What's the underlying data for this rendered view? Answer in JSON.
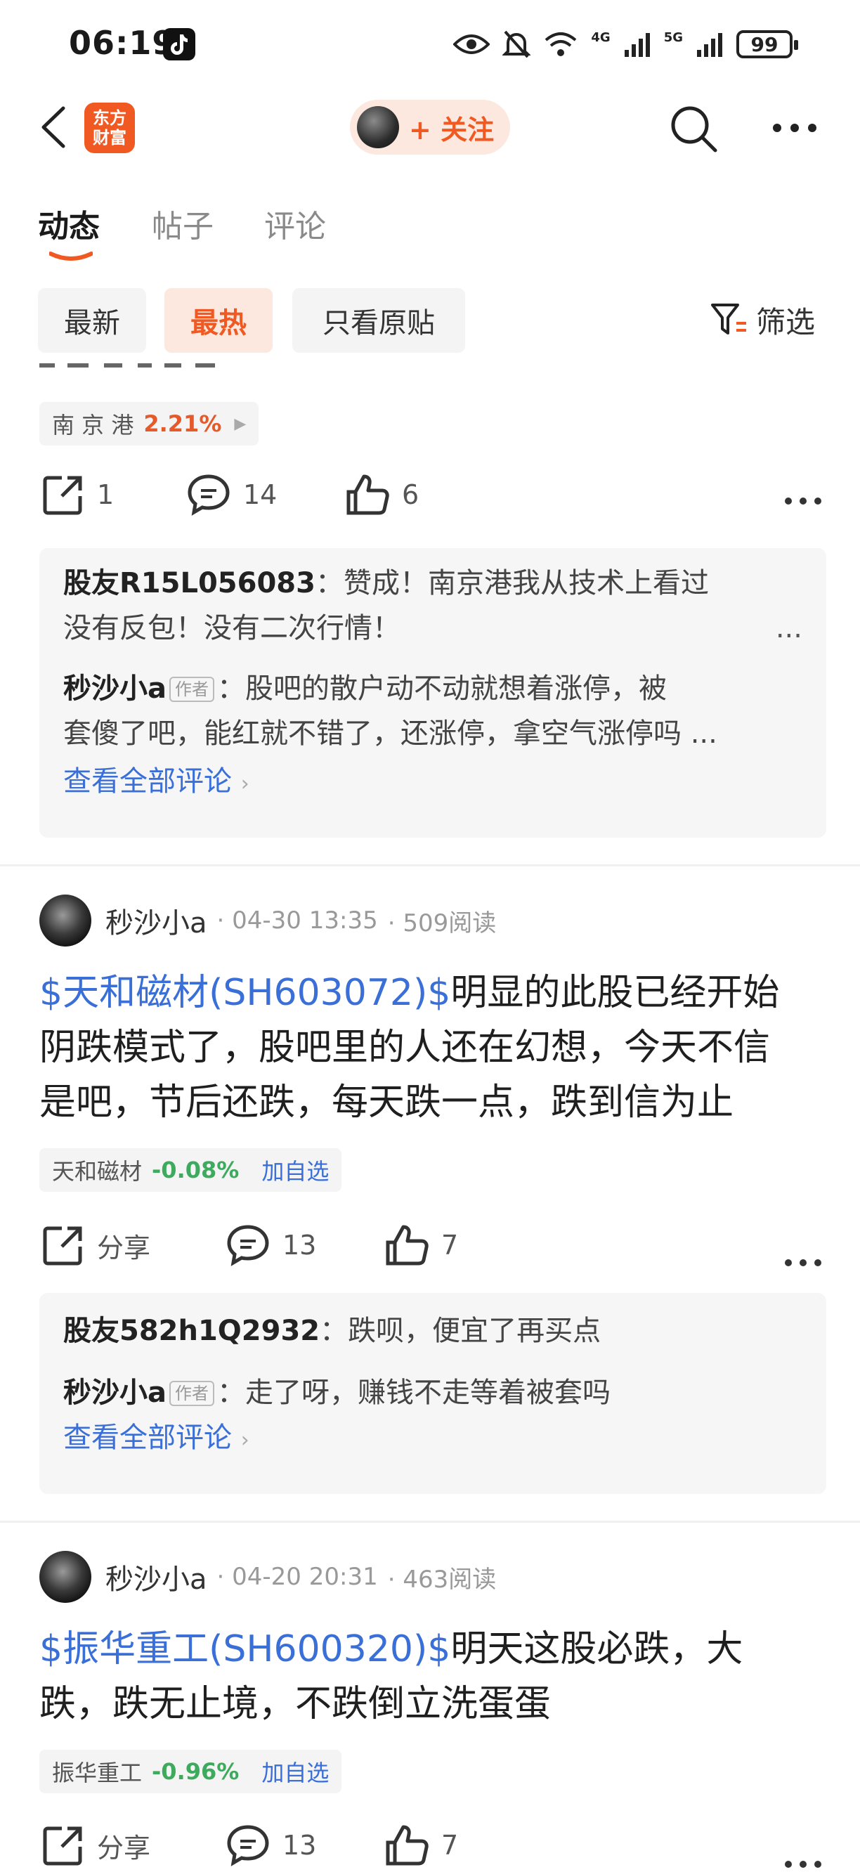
{
  "status_bar": {
    "time": "06:19",
    "battery": "99",
    "net_4g": "4G",
    "net_5g": "5G"
  },
  "header": {
    "logo_line1": "东方",
    "logo_line2": "财富",
    "follow_label": "+ 关注"
  },
  "tabs": [
    {
      "label": "动态"
    },
    {
      "label": "帖子"
    },
    {
      "label": "评论"
    }
  ],
  "filters": {
    "chips": [
      {
        "label": "最新"
      },
      {
        "label": "最热"
      },
      {
        "label": "只看原贴"
      }
    ],
    "filter_label": "筛选"
  },
  "post0": {
    "stock": {
      "name": "南 京 港",
      "pct": "2.21%"
    },
    "actions": {
      "share": "1",
      "comments": "14",
      "likes": "6"
    },
    "comments": [
      {
        "user": "股友R15L056083",
        "sep": "：",
        "line1": "赞成！南京港我从技术上看过",
        "line2": "没有反包！没有二次行情！"
      },
      {
        "user": "秒沙小a",
        "badge": "作者",
        "sep": "：",
        "line1": "股吧的散户动不动就想着涨停，被",
        "line2": "套傻了吧，能红就不错了，还涨停，拿空气涨停吗 ..."
      }
    ],
    "view_all": "查看全部评论"
  },
  "post1": {
    "user": "秒沙小a",
    "date": "· 04-30 13:35",
    "reads": "· 509阅读",
    "tag": "$天和磁材(SH603072)$",
    "line1": "明显的此股已经开始",
    "line2": "阴跌模式了，股吧里的人还在幻想，今天不信",
    "line3": "是吧，节后还跌，每天跌一点，跌到信为止",
    "stock": {
      "name": "天和磁材",
      "pct": "-0.08%",
      "add": "加自选"
    },
    "actions": {
      "share": "分享",
      "comments": "13",
      "likes": "7"
    },
    "comments": [
      {
        "user": "股友582h1Q2932",
        "sep": "：",
        "text": "跌呗，便宜了再买点"
      },
      {
        "user": "秒沙小a",
        "badge": "作者",
        "sep": "：",
        "text": "走了呀，赚钱不走等着被套吗"
      }
    ],
    "view_all": "查看全部评论"
  },
  "post2": {
    "user": "秒沙小a",
    "date": "· 04-20 20:31",
    "reads": "· 463阅读",
    "tag": "$振华重工(SH600320)$",
    "line1": "明天这股必跌，大",
    "line2": "跌，跌无止境，不跌倒立洗蛋蛋",
    "stock": {
      "name": "振华重工",
      "pct": "-0.96%",
      "add": "加自选"
    },
    "actions": {
      "share": "分享",
      "comments": "13",
      "likes": "7"
    }
  },
  "colors": {
    "accent": "#f05a22",
    "link": "#3a6fd8",
    "up": "#e55a2a",
    "down": "#3daa5d"
  },
  "icons": [
    "back-arrow-icon",
    "search-icon",
    "more-icon",
    "share-icon",
    "comment-icon",
    "like-icon",
    "filter-icon",
    "eye-icon",
    "mute-icon",
    "wifi-icon",
    "signal-icon",
    "battery-icon",
    "tiktok-icon"
  ]
}
